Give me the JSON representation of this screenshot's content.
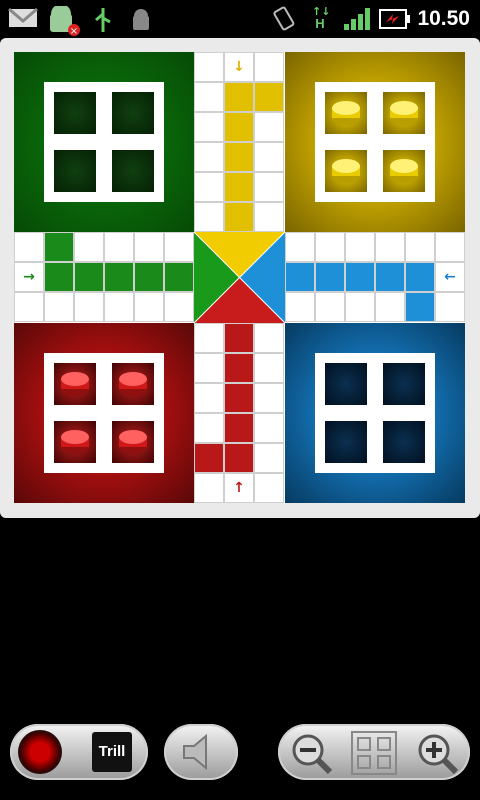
{
  "status_bar": {
    "time": "10.50",
    "icons": [
      "gmail-icon",
      "android-notification-icon",
      "usb-icon",
      "android-debug-icon",
      "screen-rotation-icon",
      "hsdpa-icon",
      "signal-icon",
      "battery-charging-icon"
    ],
    "network_label": "H"
  },
  "board": {
    "colors": {
      "green": "#0b6b0b",
      "yellow": "#c9a900",
      "red": "#b01010",
      "blue": "#1474b8",
      "track_green": "#1a8a1a",
      "track_yellow": "#e0c000",
      "track_red": "#b81818",
      "track_blue": "#1e90d8"
    },
    "bases": [
      {
        "color": "green",
        "tokens": 0
      },
      {
        "color": "yellow",
        "tokens": 4
      },
      {
        "color": "red",
        "tokens": 4
      },
      {
        "color": "blue",
        "tokens": 0
      }
    ],
    "arrows": {
      "top": "↓",
      "left": "→",
      "right": "←",
      "bottom": "↑"
    }
  },
  "controls": {
    "trill_label": "Trill",
    "icons": [
      "record-icon",
      "sound-icon",
      "zoom-out-icon",
      "layout-icon",
      "zoom-in-icon"
    ]
  }
}
